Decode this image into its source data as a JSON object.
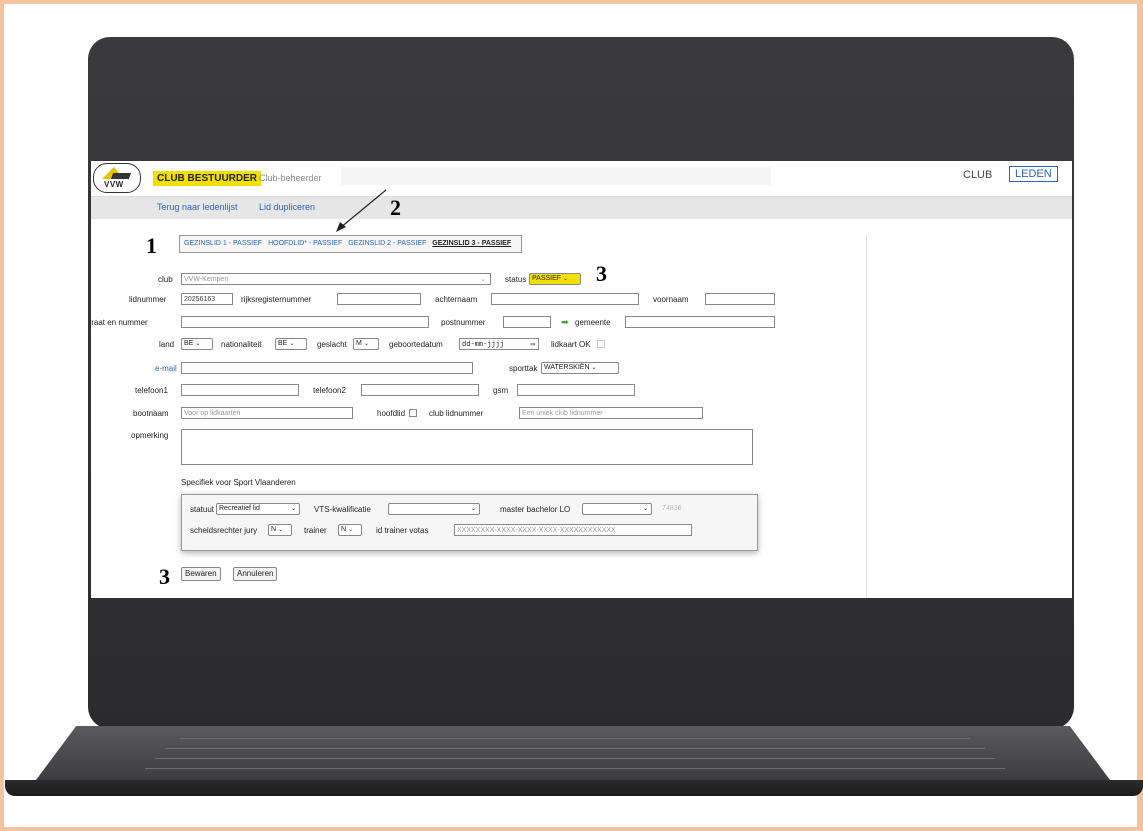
{
  "topbar": {
    "logo_text": "VVW",
    "role_badge": "CLUB BESTUURDER",
    "role_sub": "Club-beheerder",
    "club_link": "CLUB",
    "leden_button": "LEDEN"
  },
  "subnav": {
    "back": "Terug naar ledenlijst",
    "duplicate": "Lid dupliceren"
  },
  "tabs": [
    {
      "label": "GEZINSLID 1 - PASSIEF",
      "active": false
    },
    {
      "label": "HOOFDLID* - PASSIEF",
      "active": false
    },
    {
      "label": "GEZINSLID 2 - PASSIEF",
      "active": false
    },
    {
      "label": "GEZINSLID 3 - PASSIEF",
      "active": true
    }
  ],
  "form": {
    "club_label": "club",
    "club_value": "VVW-Kempen",
    "status_label": "status",
    "status_value": "PASSIEF",
    "lidnummer_label": "lidnummer",
    "lidnummer_value": "20256163",
    "rijksregister_label": "rijksregisternummer",
    "achternaam_label": "achternaam",
    "voornaam_label": "voornaam",
    "straat_label": "straat en nummer",
    "postnummer_label": "postnummer",
    "gemeente_label": "gemeente",
    "land_label": "land",
    "land_value": "BE",
    "nationaliteit_label": "nationaliteit",
    "nationaliteit_value": "BE",
    "geslacht_label": "geslacht",
    "geslacht_value": "M",
    "geboortedatum_label": "geboortedatum",
    "geboortedatum_placeholder": "dd-mm-jjjj",
    "lidkaart_label": "lidkaart OK",
    "email_label": "e-mail",
    "sporttak_label": "sporttak",
    "sporttak_value": "WATERSKIËN",
    "telefoon1_label": "telefoon1",
    "telefoon2_label": "telefoon2",
    "gsm_label": "gsm",
    "bootnaam_label": "bootnaam",
    "bootnaam_placeholder": "Voor op lidkaarten",
    "hoofdlid_label": "hoofdlid",
    "club_lidnummer_label": "club lidnummer",
    "club_lidnummer_placeholder": "Een uniek club lidnummer",
    "opmerking_label": "opmerking"
  },
  "sport_vlaanderen": {
    "heading": "Specifiek voor Sport Vlaanderen",
    "statuut_label": "statuut",
    "statuut_value": "Recreatief lid",
    "vts_label": "VTS-kwalificatie",
    "vts_value": "",
    "master_label": "master bachelor LO",
    "master_value": "",
    "code": "74836",
    "scheidsrechter_label": "scheidsrechter jury",
    "scheidsrechter_value": "N",
    "trainer_label": "trainer",
    "trainer_value": "N",
    "id_trainer_label": "id trainer votas",
    "id_trainer_placeholder": "XXXXXXXX-XXXX-XXXX-XXXX-XXXXXXXXXXXX"
  },
  "actions": {
    "save": "Bewaren",
    "cancel": "Annuleren"
  },
  "annotations": {
    "tabs_marker": "1",
    "arrow_marker": "2",
    "status_marker": "3",
    "buttons_marker": "3"
  },
  "colors": {
    "badge_yellow": "#f4e000",
    "link_blue": "#2c64b8",
    "laptop_dark": "#333335",
    "frame_peach": "#f6c39f"
  }
}
